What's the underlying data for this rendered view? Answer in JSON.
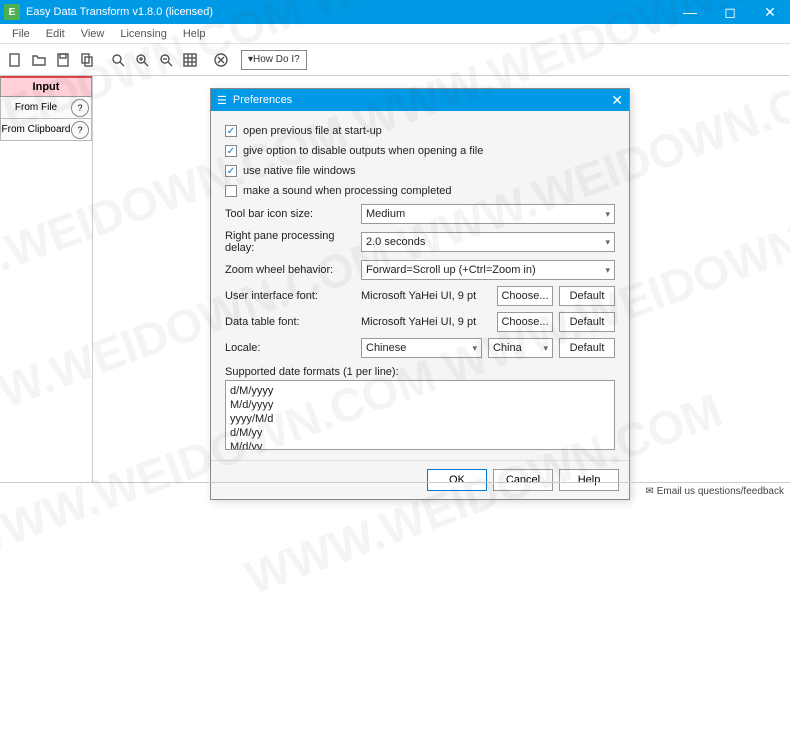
{
  "window": {
    "title": "Easy Data Transform v1.8.0 (licensed)"
  },
  "menu": {
    "file": "File",
    "edit": "Edit",
    "view": "View",
    "licensing": "Licensing",
    "help": "Help"
  },
  "toolbar": {
    "howdoi": "▾How Do I?"
  },
  "sidebar": {
    "input_tab": "Input",
    "from_file": "From File",
    "from_clipboard": "From Clipboard",
    "help": "?"
  },
  "dialog": {
    "title": "Preferences",
    "checks": {
      "open_prev": "open previous file at start-up",
      "disable_outputs": "give option to disable outputs when opening a file",
      "native_windows": "use native file windows",
      "sound": "make a sound when processing completed"
    },
    "labels": {
      "toolbar_icon": "Tool bar icon size:",
      "right_pane_delay": "Right pane processing delay:",
      "zoom_wheel": "Zoom wheel behavior:",
      "ui_font": "User interface font:",
      "table_font": "Data table font:",
      "locale": "Locale:",
      "supported_dates": "Supported date formats (1 per line):"
    },
    "values": {
      "toolbar_icon": "Medium",
      "right_pane_delay": "2.0 seconds",
      "zoom_wheel": "Forward=Scroll up (+Ctrl=Zoom in)",
      "ui_font": "Microsoft YaHei UI, 9 pt",
      "table_font": "Microsoft YaHei UI, 9 pt",
      "locale_lang": "Chinese",
      "locale_country": "China",
      "date_formats": "d/M/yyyy\nM/d/yyyy\nyyyy/M/d\nd/M/yy\nM/d/yy"
    },
    "buttons": {
      "choose": "Choose...",
      "default": "Default",
      "ok": "OK",
      "cancel": "Cancel",
      "help": "Help"
    }
  },
  "status": {
    "feedback": "Email us questions/feedback"
  },
  "watermark": "WWW.WEIDOWN.COM"
}
